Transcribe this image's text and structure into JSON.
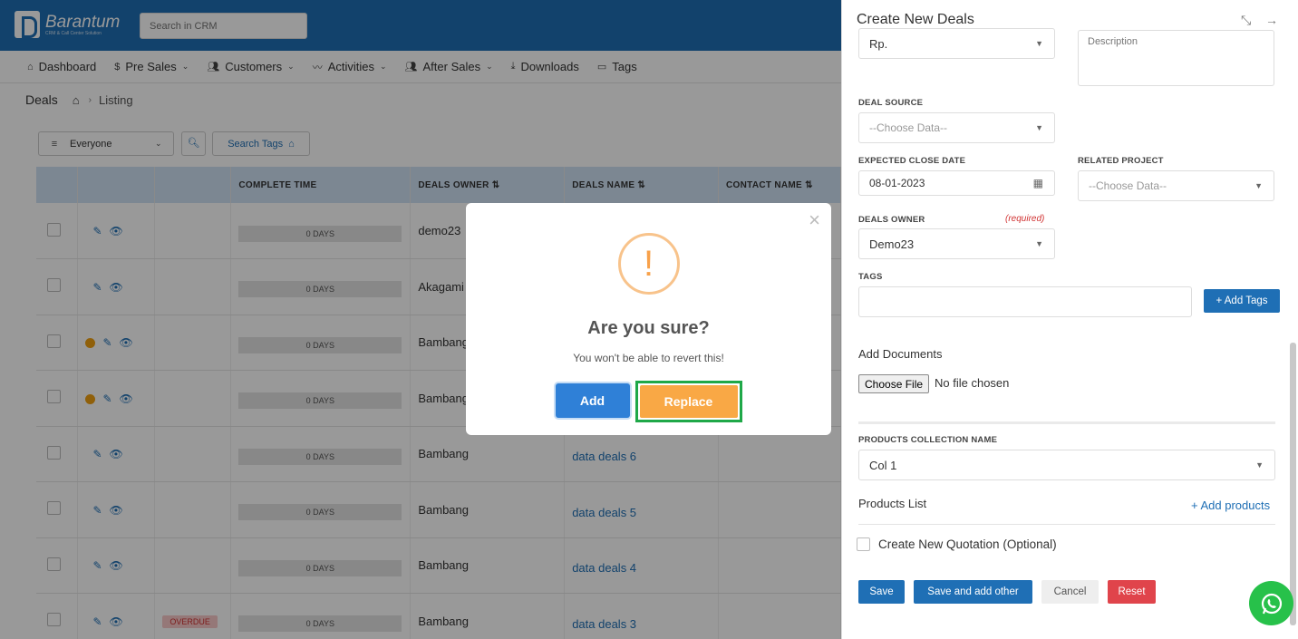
{
  "app": {
    "logo_text": "Barantum",
    "logo_sub": "CRM & Call Center Solution",
    "search_placeholder": "Search in CRM"
  },
  "nav": [
    {
      "label": "Dashboard",
      "icon": "home-icon"
    },
    {
      "label": "Pre Sales",
      "icon": "dollar-icon",
      "dropdown": true
    },
    {
      "label": "Customers",
      "icon": "users-icon",
      "dropdown": true
    },
    {
      "label": "Activities",
      "icon": "activity-icon",
      "dropdown": true
    },
    {
      "label": "After Sales",
      "icon": "users-icon",
      "dropdown": true
    },
    {
      "label": "Downloads",
      "icon": "download-icon"
    },
    {
      "label": "Tags",
      "icon": "folder-icon"
    }
  ],
  "breadcrumb": {
    "title": "Deals",
    "leaf": "Listing"
  },
  "filter": {
    "value": "Everyone",
    "tags_label": "Search Tags"
  },
  "table": {
    "headers": [
      "COMPLETE TIME",
      "DEALS OWNER ⇅",
      "DEALS NAME ⇅",
      "CONTACT NAME ⇅"
    ],
    "rows": [
      {
        "dot": false,
        "overdue": "",
        "days": "0 DAYS",
        "owner": "demo23",
        "name": ""
      },
      {
        "dot": false,
        "overdue": "",
        "days": "0 DAYS",
        "owner": "Akagami",
        "name": ""
      },
      {
        "dot": true,
        "overdue": "",
        "days": "0 DAYS",
        "owner": "Bambang",
        "name": ""
      },
      {
        "dot": true,
        "overdue": "",
        "days": "0 DAYS",
        "owner": "Bambang",
        "name": ""
      },
      {
        "dot": false,
        "overdue": "",
        "days": "0 DAYS",
        "owner": "Bambang",
        "name": "data deals 6"
      },
      {
        "dot": false,
        "overdue": "",
        "days": "0 DAYS",
        "owner": "Bambang",
        "name": "data deals 5"
      },
      {
        "dot": false,
        "overdue": "",
        "days": "0 DAYS",
        "owner": "Bambang",
        "name": "data deals 4"
      },
      {
        "dot": false,
        "overdue": "OVERDUE",
        "days": "0 DAYS",
        "owner": "Bambang",
        "name": "data deals 3"
      }
    ]
  },
  "dialog": {
    "icon": "!",
    "title": "Are you sure?",
    "text": "You won't be able to revert this!",
    "add_label": "Add",
    "replace_label": "Replace"
  },
  "panel": {
    "title": "Create New Deals",
    "currency": "Rp.",
    "description_label": "Description",
    "deal_source_label": "DEAL SOURCE",
    "deal_source_value": "--Choose Data--",
    "close_date_label": "EXPECTED CLOSE DATE",
    "close_date_value": "08-01-2023",
    "related_project_label": "RELATED PROJECT",
    "related_project_value": "--Choose Data--",
    "owner_label": "DEALS OWNER",
    "owner_required": "(required)",
    "owner_value": "Demo23",
    "tags_label": "TAGS",
    "add_tags": "+ Add Tags",
    "documents_label": "Add Documents",
    "choose_file": "Choose File",
    "no_file": "No file chosen",
    "collection_label": "PRODUCTS COLLECTION NAME",
    "collection_value": "Col 1",
    "products_list": "Products List",
    "add_products": "+ Add products",
    "quotation": "Create New Quotation (Optional)",
    "save": "Save",
    "save_add": "Save and add other",
    "cancel": "Cancel",
    "reset": "Reset"
  }
}
